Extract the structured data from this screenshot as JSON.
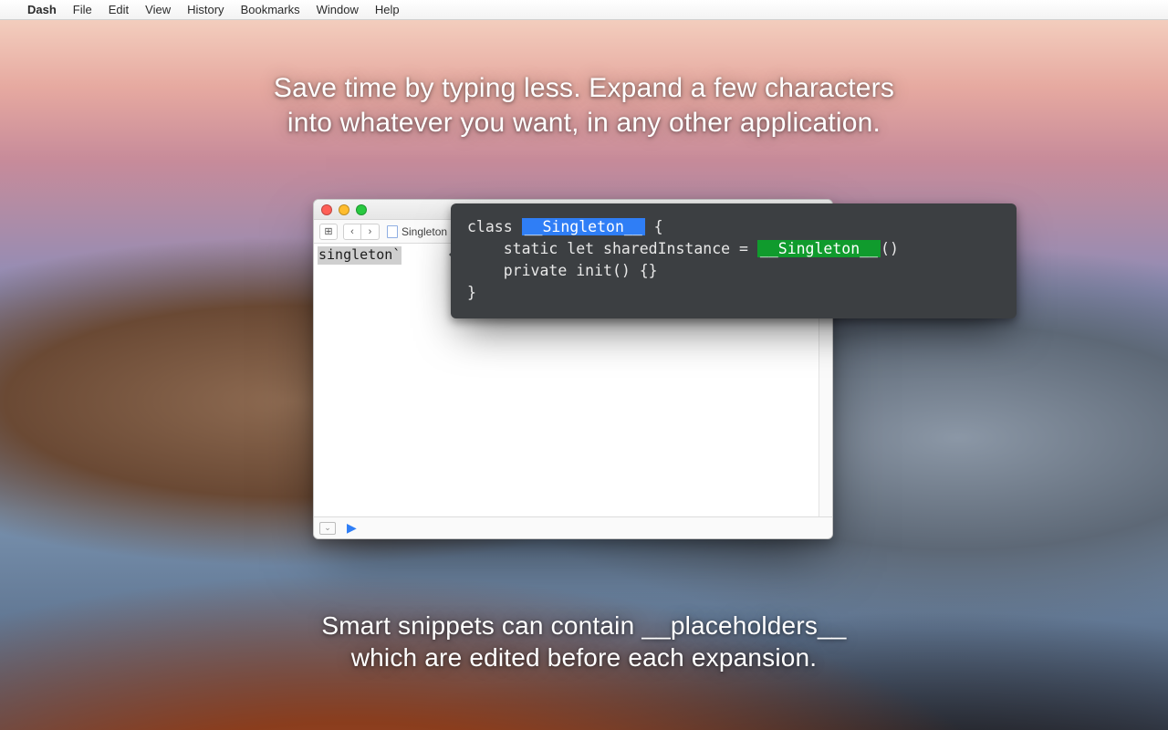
{
  "menubar": {
    "apple_glyph": "",
    "app_name": "Dash",
    "items": [
      "File",
      "Edit",
      "View",
      "History",
      "Bookmarks",
      "Window",
      "Help"
    ]
  },
  "hero": {
    "top_line1": "Save time by typing less. Expand a few characters",
    "top_line2": "into whatever you want, in any other application.",
    "bottom_line1": "Smart snippets can contain __placeholders__",
    "bottom_line2": "which are edited before each expansion."
  },
  "editor": {
    "file_label": "Singleton",
    "typed_text": "singleton`",
    "nav_back_glyph": "‹",
    "nav_fwd_glyph": "›",
    "grid_glyph": "⊞",
    "collapse_glyph": "⌄",
    "play_glyph": "▶"
  },
  "snippet": {
    "l1a": "class ",
    "l1b": "__Singleton__",
    "l1c": " {",
    "l2a": "    static let sharedInstance = ",
    "l2b": "__Singleton__",
    "l2c": "()",
    "l3": "    private init() {}",
    "l4": "}"
  }
}
